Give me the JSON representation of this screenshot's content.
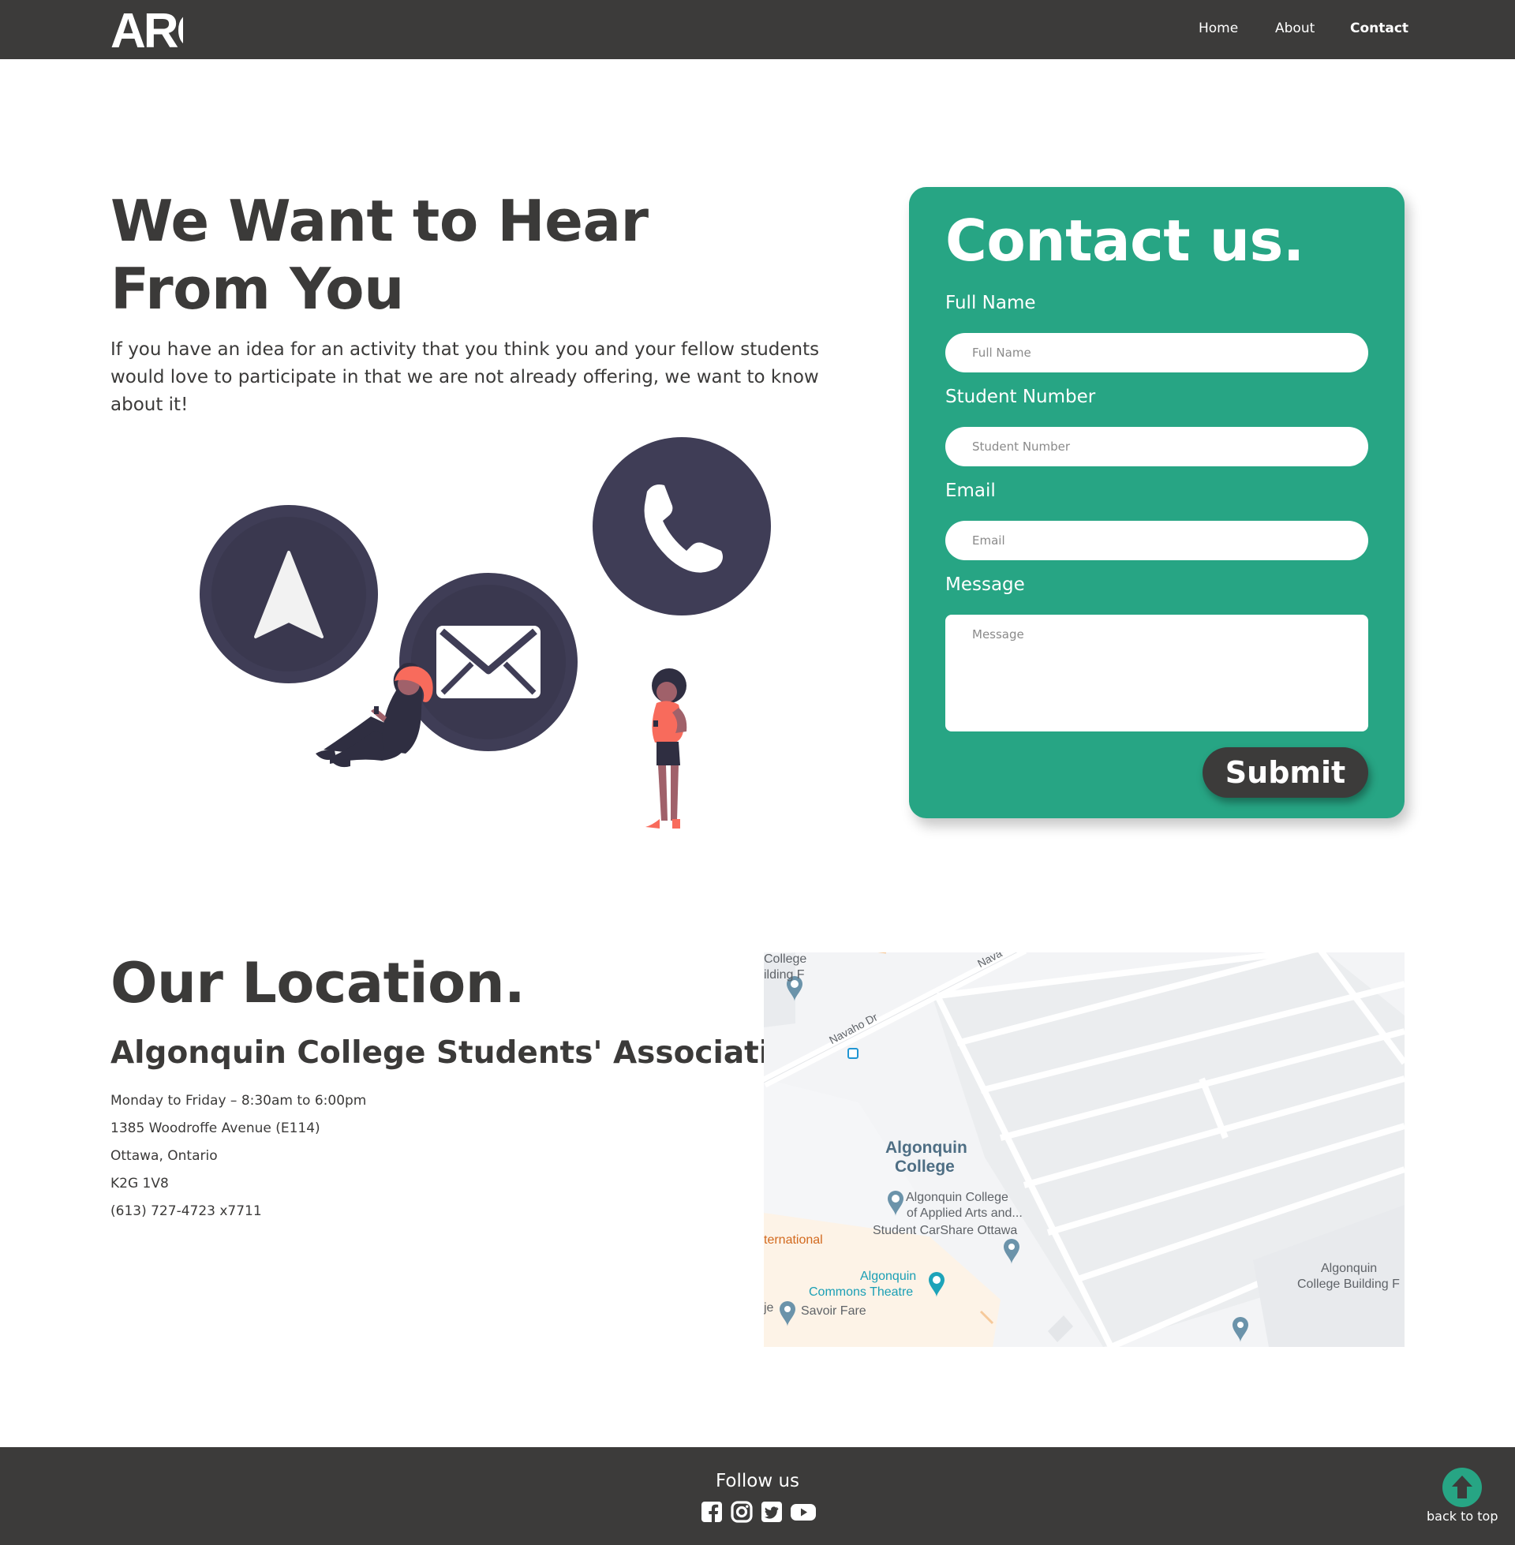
{
  "header": {
    "logo_text": "ARC",
    "nav": [
      {
        "label": "Home",
        "active": false
      },
      {
        "label": "About",
        "active": false
      },
      {
        "label": "Contact",
        "active": true
      }
    ]
  },
  "hero": {
    "title": "We Want to Hear From You",
    "text": "If you have an idea for an activity that you think you and your fellow students would love to participate in that we are not already offering, we want to know about it!"
  },
  "contact_form": {
    "title": "Contact us.",
    "fields": [
      {
        "label": "Full Name",
        "placeholder": "Full Name",
        "value": ""
      },
      {
        "label": "Student Number",
        "placeholder": "Student Number",
        "value": ""
      },
      {
        "label": "Email",
        "placeholder": "Email",
        "value": ""
      },
      {
        "label": "Message",
        "placeholder": "Message",
        "value": ""
      }
    ],
    "submit_label": "Submit"
  },
  "location": {
    "title": "Our Location.",
    "subtitle": "Algonquin College Students' Association",
    "lines": [
      "Monday to Friday – 8:30am to 6:00pm",
      "1385 Woodroffe Avenue (E114)",
      "Ottawa, Ontario",
      "K2G 1V8",
      "(613) 727-4723 x7711"
    ]
  },
  "map": {
    "labels": {
      "college_f1": "College",
      "college_f2": "ilding F",
      "navaho1": "Navaho Dr",
      "navaho2": "Nava",
      "algonquin1": "Algonquin",
      "algonquin2": "College",
      "aaa1": "Algonquin College",
      "aaa2": "of Applied Arts and...",
      "carshare": "Student CarShare Ottawa",
      "international": "ternational",
      "commons1": "Algonquin",
      "commons2": "Commons Theatre",
      "savoir": "Savoir Fare",
      "je": "je",
      "bldg1": "Algonquin",
      "bldg2": "College Building F"
    }
  },
  "footer": {
    "follow_label": "Follow us",
    "social_icons": [
      "facebook-icon",
      "instagram-icon",
      "twitter-icon",
      "youtube-icon"
    ],
    "back_to_top_label": "back to top"
  },
  "colors": {
    "accent": "#27a584",
    "dark": "#3c3b3a",
    "illustration_dark": "#3f3d56",
    "illustration_accent": "#f86b5c"
  }
}
